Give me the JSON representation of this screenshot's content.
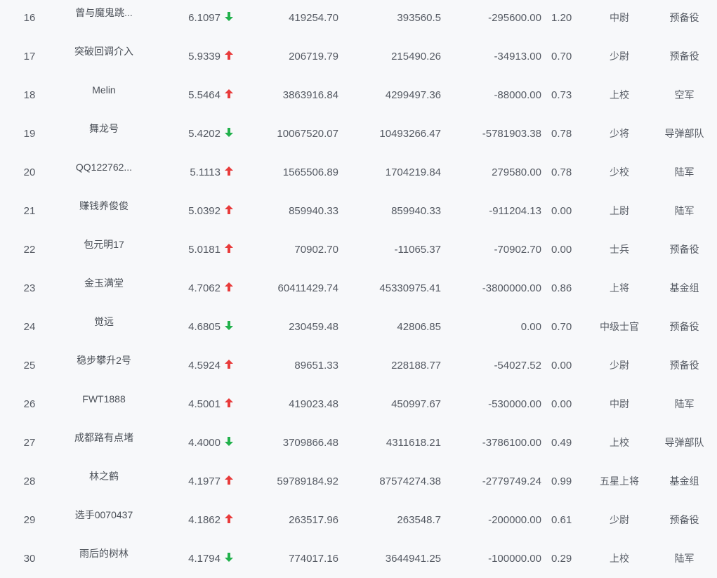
{
  "colors": {
    "up": "#e83b3b",
    "down": "#22b14c",
    "background": "#f7f8fa",
    "text": "#555a63"
  },
  "rows": [
    {
      "rank": "16",
      "name": "曾与魔鬼跳...",
      "score": "6.1097",
      "trend": "down",
      "total": "419254.70",
      "net": "393560.5",
      "flow": "-295600.00",
      "position": "1.20",
      "level": "中尉",
      "army": "预备役"
    },
    {
      "rank": "17",
      "name": "突破回调介入",
      "score": "5.9339",
      "trend": "up",
      "total": "206719.79",
      "net": "215490.26",
      "flow": "-34913.00",
      "position": "0.70",
      "level": "少尉",
      "army": "预备役"
    },
    {
      "rank": "18",
      "name": "Melin",
      "score": "5.5464",
      "trend": "up",
      "total": "3863916.84",
      "net": "4299497.36",
      "flow": "-88000.00",
      "position": "0.73",
      "level": "上校",
      "army": "空军"
    },
    {
      "rank": "19",
      "name": "舞龙号",
      "score": "5.4202",
      "trend": "down",
      "total": "10067520.07",
      "net": "10493266.47",
      "flow": "-5781903.38",
      "position": "0.78",
      "level": "少将",
      "army": "导弹部队"
    },
    {
      "rank": "20",
      "name": "QQ122762...",
      "score": "5.1113",
      "trend": "up",
      "total": "1565506.89",
      "net": "1704219.84",
      "flow": "279580.00",
      "position": "0.78",
      "level": "少校",
      "army": "陆军"
    },
    {
      "rank": "21",
      "name": "赚钱养俊俊",
      "score": "5.0392",
      "trend": "up",
      "total": "859940.33",
      "net": "859940.33",
      "flow": "-911204.13",
      "position": "0.00",
      "level": "上尉",
      "army": "陆军"
    },
    {
      "rank": "22",
      "name": "包元明17",
      "score": "5.0181",
      "trend": "up",
      "total": "70902.70",
      "net": "-11065.37",
      "flow": "-70902.70",
      "position": "0.00",
      "level": "士兵",
      "army": "预备役"
    },
    {
      "rank": "23",
      "name": "金玉满堂",
      "score": "4.7062",
      "trend": "up",
      "total": "60411429.74",
      "net": "45330975.41",
      "flow": "-3800000.00",
      "position": "0.86",
      "level": "上将",
      "army": "基金组"
    },
    {
      "rank": "24",
      "name": "觉远",
      "score": "4.6805",
      "trend": "down",
      "total": "230459.48",
      "net": "42806.85",
      "flow": "0.00",
      "position": "0.70",
      "level": "中级士官",
      "army": "预备役"
    },
    {
      "rank": "25",
      "name": "稳步攀升2号",
      "score": "4.5924",
      "trend": "up",
      "total": "89651.33",
      "net": "228188.77",
      "flow": "-54027.52",
      "position": "0.00",
      "level": "少尉",
      "army": "预备役"
    },
    {
      "rank": "26",
      "name": "FWT1888",
      "score": "4.5001",
      "trend": "up",
      "total": "419023.48",
      "net": "450997.67",
      "flow": "-530000.00",
      "position": "0.00",
      "level": "中尉",
      "army": "陆军"
    },
    {
      "rank": "27",
      "name": "成都路有点堵",
      "score": "4.4000",
      "trend": "down",
      "total": "3709866.48",
      "net": "4311618.21",
      "flow": "-3786100.00",
      "position": "0.49",
      "level": "上校",
      "army": "导弹部队"
    },
    {
      "rank": "28",
      "name": "林之鹤",
      "score": "4.1977",
      "trend": "up",
      "total": "59789184.92",
      "net": "87574274.38",
      "flow": "-2779749.24",
      "position": "0.99",
      "level": "五星上将",
      "army": "基金组"
    },
    {
      "rank": "29",
      "name": "选手0070437",
      "score": "4.1862",
      "trend": "up",
      "total": "263517.96",
      "net": "263548.7",
      "flow": "-200000.00",
      "position": "0.61",
      "level": "少尉",
      "army": "预备役"
    },
    {
      "rank": "30",
      "name": "雨后的树林",
      "score": "4.1794",
      "trend": "down",
      "total": "774017.16",
      "net": "3644941.25",
      "flow": "-100000.00",
      "position": "0.29",
      "level": "上校",
      "army": "陆军"
    }
  ]
}
